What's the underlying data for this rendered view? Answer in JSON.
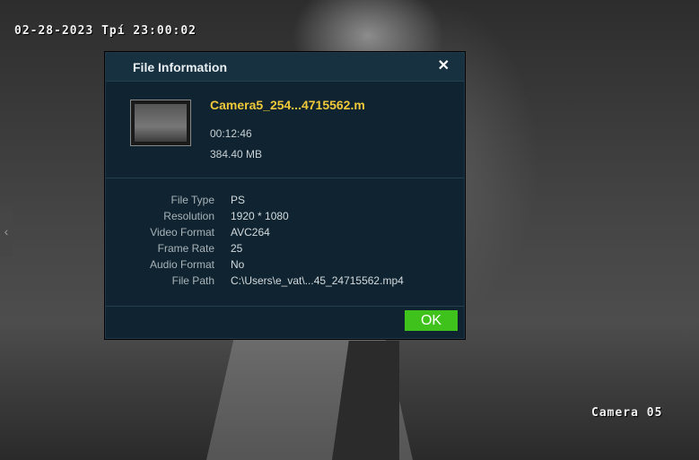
{
  "video": {
    "timestamp": "02-28-2023 Tpí 23:00:02",
    "camera_label": "Camera 05"
  },
  "dialog": {
    "title": "File Information",
    "close_glyph": "✕",
    "file_name": "Camera5_254...4715562.m",
    "duration": "00:12:46",
    "size": "384.40 MB",
    "rows": [
      {
        "label": "File Type",
        "value": "PS"
      },
      {
        "label": "Resolution",
        "value": "1920 * 1080"
      },
      {
        "label": "Video Format",
        "value": "AVC264"
      },
      {
        "label": "Frame Rate",
        "value": "25"
      },
      {
        "label": "Audio Format",
        "value": "No"
      },
      {
        "label": "File Path",
        "value": "C:\\Users\\e_vat\\...45_24715562.mp4"
      }
    ],
    "ok_label": "OK"
  },
  "colors": {
    "accent_ok": "#3fc21b",
    "file_name": "#f0c93a",
    "dialog_bg": "#0f2330",
    "dialog_header": "#173140"
  },
  "side_handle_glyph": "‹"
}
